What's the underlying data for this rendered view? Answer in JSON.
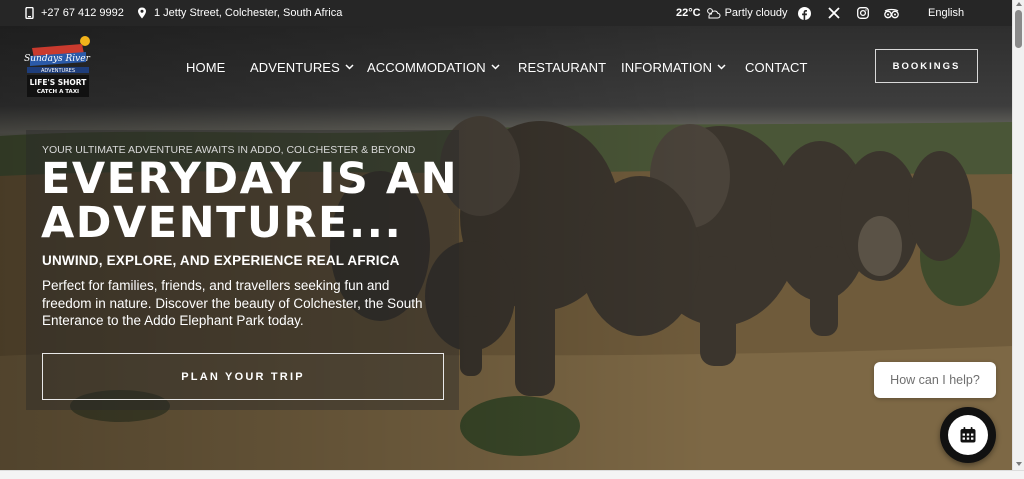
{
  "topbar": {
    "phone": "+27 67 412 9992",
    "address": "1 Jetty Street, Colchester, South Africa",
    "temperature": "22°C",
    "weather": "Partly cloudy",
    "social_icons": [
      "facebook-icon",
      "x-icon",
      "instagram-icon",
      "tripadvisor-icon"
    ],
    "language": "English"
  },
  "logo": {
    "line1": "Sundays River",
    "line2": "ADVENTURES",
    "line3": "LIFE'S SHORT",
    "line4": "CATCH A TAXI"
  },
  "nav": {
    "items": [
      {
        "label": "HOME",
        "dropdown": false
      },
      {
        "label": "ADVENTURES",
        "dropdown": true
      },
      {
        "label": "ACCOMMODATION",
        "dropdown": true
      },
      {
        "label": "RESTAURANT",
        "dropdown": false
      },
      {
        "label": "INFORMATION",
        "dropdown": true
      },
      {
        "label": "CONTACT",
        "dropdown": false
      }
    ],
    "bookings_label": "BOOKINGS"
  },
  "hero": {
    "kicker": "YOUR ULTIMATE ADVENTURE AWAITS IN ADDO, COLCHESTER & BEYOND",
    "headline_line1": "EVERYDAY IS AN",
    "headline_line2": "ADVENTURE...",
    "subhead": "UNWIND, EXPLORE, AND EXPERIENCE REAL AFRICA",
    "description": "Perfect for families, friends, and travellers seeking fun and freedom in nature. Discover the beauty of Colchester, the South Enterance to the Addo Elephant Park today.",
    "cta_label": "PLAN YOUR TRIP"
  },
  "chat": {
    "prompt": "How can I help?"
  },
  "colors": {
    "topbar_bg": "#262626",
    "text_light": "#ffffff",
    "chat_button": "#111111"
  }
}
